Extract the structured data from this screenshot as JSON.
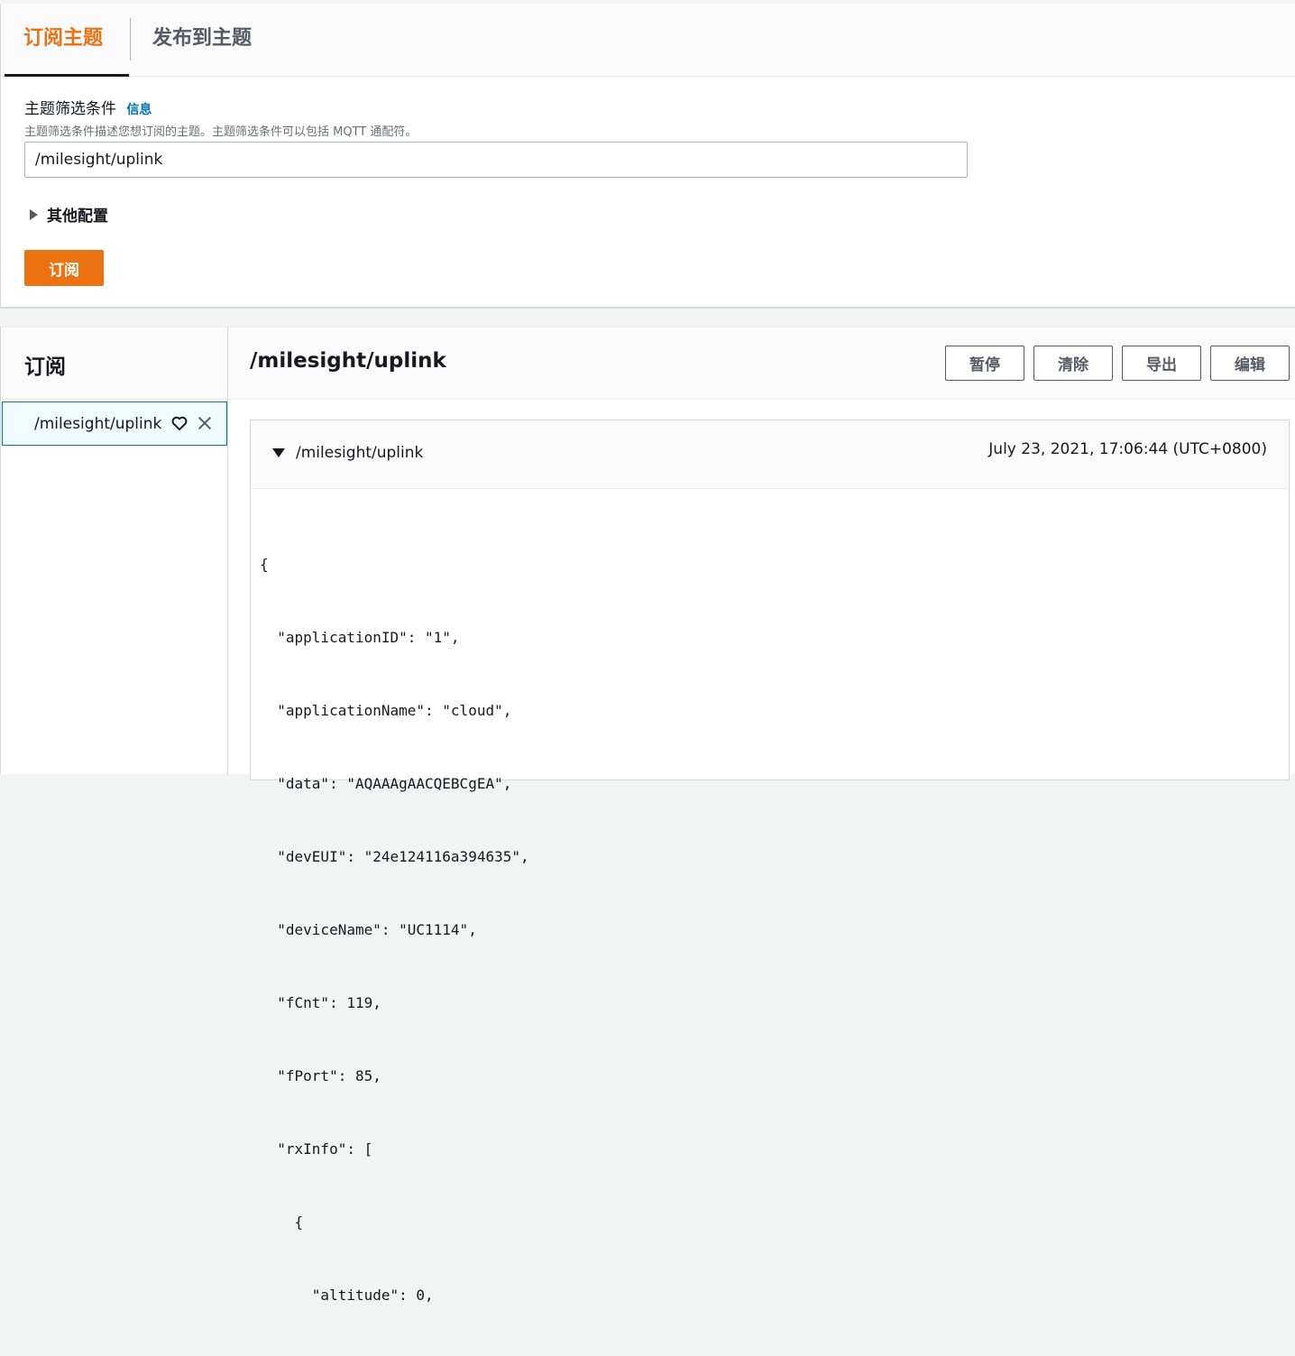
{
  "tabs": {
    "subscribe": "订阅主题",
    "publish": "发布到主题"
  },
  "filter": {
    "label": "主题筛选条件",
    "info_link": "信息",
    "description": "主题筛选条件描述您想订阅的主题。主题筛选条件可以包括 MQTT 通配符。",
    "value": "/milesight/uplink"
  },
  "more_config": "其他配置",
  "subscribe_button": "订阅",
  "sidebar": {
    "title": "订阅",
    "items": [
      {
        "topic": "/milesight/uplink"
      }
    ]
  },
  "main": {
    "title": "/milesight/uplink",
    "buttons": {
      "pause": "暂停",
      "clear": "清除",
      "export": "导出",
      "edit": "编辑"
    },
    "message": {
      "topic": "/milesight/uplink",
      "timestamp": "July 23, 2021, 17:06:44 (UTC+0800)",
      "lines": [
        "{",
        "  \"applicationID\": \"1\",",
        "  \"applicationName\": \"cloud\",",
        "  \"data\": \"AQAAAgAACQEBCgEA\",",
        "  \"devEUI\": \"24e124116a394635\",",
        "  \"deviceName\": \"UC1114\",",
        "  \"fCnt\": 119,",
        "  \"fPort\": 85,",
        "  \"rxInfo\": [",
        "    {",
        "      \"altitude\": 0,"
      ]
    }
  }
}
